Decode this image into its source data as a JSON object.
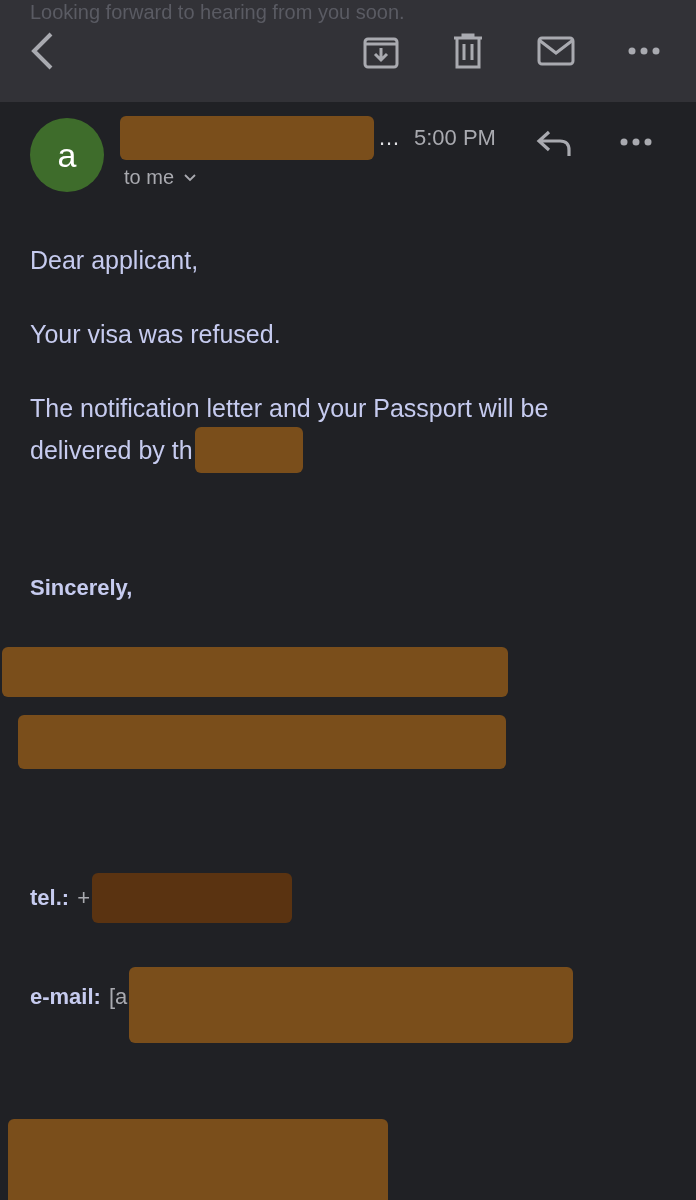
{
  "faded_text": "Looking forward to hearing from you soon.",
  "message": {
    "avatar_letter": "a",
    "sender_ellipsis": "…",
    "time": "5:00 PM",
    "recipient": "to me"
  },
  "body": [
    [
      "Dear applicant,"
    ],
    [
      "Your visa was refused."
    ],
    [
      "The notification letter and your Passport will be",
      "delivered by th"
    ]
  ],
  "closing": "Sincerely,",
  "contacts": [
    {
      "label": "tel.:",
      "value": "+"
    },
    {
      "label": "e-mail:",
      "value": "[a"
    }
  ]
}
